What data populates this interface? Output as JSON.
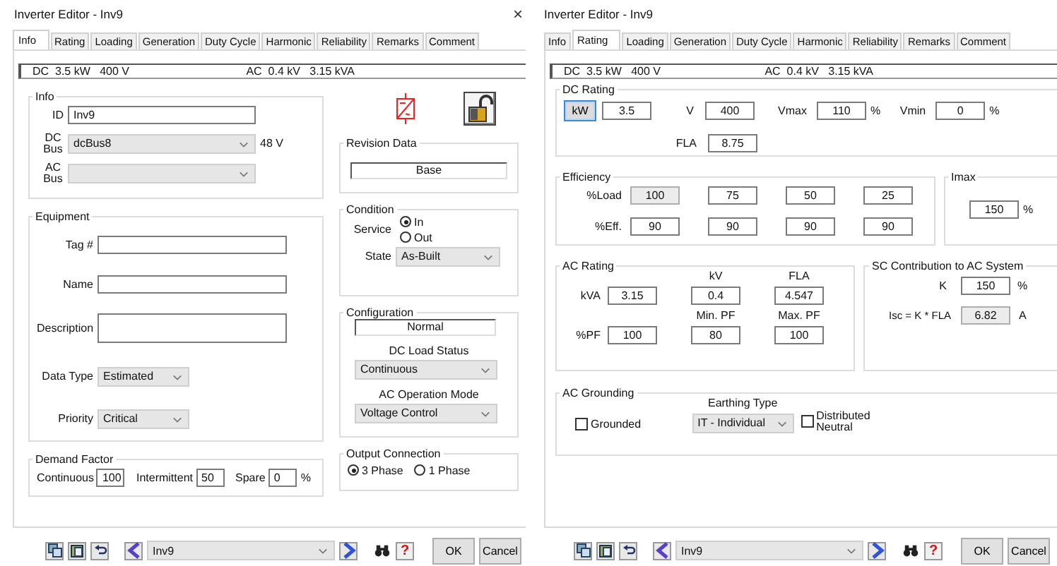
{
  "windows": [
    {
      "kind": "info",
      "title": "Inverter Editor - Inv9",
      "close": "×",
      "tabs": [
        {
          "label": "Info",
          "selected": true
        },
        {
          "label": "Rating",
          "selected": false
        },
        {
          "label": "Loading",
          "selected": false
        },
        {
          "label": "Generation",
          "selected": false
        },
        {
          "label": "Duty Cycle",
          "selected": false
        },
        {
          "label": "Harmonic",
          "selected": false
        },
        {
          "label": "Reliability",
          "selected": false
        },
        {
          "label": "Remarks",
          "selected": false
        },
        {
          "label": "Comment",
          "selected": false
        }
      ],
      "summary": {
        "dc": "DC  3.5 kW   400 V",
        "ac": "AC  0.4 kV   3.15 kVA"
      },
      "info": {
        "title": "Info",
        "id_label": "ID",
        "id_value": "Inv9",
        "dc_bus_label": "DC Bus",
        "dc_bus_value": "dcBus8",
        "dc_bus_voltage": "48 V",
        "ac_bus_label": "AC Bus"
      },
      "revision": {
        "title": "Revision Data",
        "value": "Base"
      },
      "equipment": {
        "title": "Equipment",
        "fields": [
          {
            "label": "Tag #",
            "kind": "line"
          },
          {
            "label": "Name",
            "kind": "line"
          },
          {
            "label": "Description",
            "kind": "tall"
          }
        ],
        "dropdowns": [
          {
            "label": "Data Type",
            "value": "Estimated"
          },
          {
            "label": "Priority",
            "value": "Critical"
          }
        ]
      },
      "condition": {
        "title": "Condition",
        "service_label": "Service",
        "options": [
          {
            "label": "In",
            "selected": true
          },
          {
            "label": "Out",
            "selected": false
          }
        ],
        "state_label": "State",
        "state_value": "As-Built"
      },
      "configuration": {
        "title": "Configuration",
        "value": "Normal",
        "dc_load_label": "DC Load Status",
        "dc_load_value": "Continuous",
        "ac_mode_label": "AC Operation Mode",
        "ac_mode_value": "Voltage Control"
      },
      "demand_factor": {
        "title": "Demand Factor",
        "items": [
          {
            "label": "Continuous",
            "value": "100"
          },
          {
            "label": "Intermittent",
            "value": "50"
          },
          {
            "label": "Spare",
            "value": "0",
            "unit": "%"
          }
        ]
      },
      "output_connection": {
        "title": "Output Connection",
        "options": [
          {
            "label": "3 Phase",
            "selected": true
          },
          {
            "label": "1 Phase",
            "selected": false
          }
        ]
      },
      "toolbar": {
        "item": "Inv9",
        "help": "?",
        "ok": "OK",
        "cancel": "Cancel"
      }
    },
    {
      "kind": "rating",
      "title": "Inverter Editor - Inv9",
      "tabs": [
        {
          "label": "Info",
          "selected": false
        },
        {
          "label": "Rating",
          "selected": true
        },
        {
          "label": "Loading",
          "selected": false
        },
        {
          "label": "Generation",
          "selected": false
        },
        {
          "label": "Duty Cycle",
          "selected": false
        },
        {
          "label": "Harmonic",
          "selected": false
        },
        {
          "label": "Reliability",
          "selected": false
        },
        {
          "label": "Remarks",
          "selected": false
        },
        {
          "label": "Comment",
          "selected": false
        }
      ],
      "summary": {
        "dc": "DC  3.5 kW   400 V",
        "ac": "AC  0.4 kV   3.15 kVA"
      },
      "dc_rating": {
        "title": "DC Rating",
        "unit_button": "kW",
        "power": "3.5",
        "v_label": "V",
        "v": "400",
        "vmax_label": "Vmax",
        "vmax": "110",
        "vmax_unit": "%",
        "vmin_label": "Vmin",
        "vmin": "0",
        "vmin_unit": "%",
        "fla_label": "FLA",
        "fla": "8.75"
      },
      "efficiency": {
        "title": "Efficiency",
        "rows": [
          {
            "label": "%Load",
            "cells": [
              {
                "value": "100",
                "disabled": true
              },
              {
                "value": "75",
                "disabled": false
              },
              {
                "value": "50",
                "disabled": false
              },
              {
                "value": "25",
                "disabled": false
              }
            ]
          },
          {
            "label": "%Eff.",
            "cells": [
              {
                "value": "90",
                "disabled": false
              },
              {
                "value": "90",
                "disabled": false
              },
              {
                "value": "90",
                "disabled": false
              },
              {
                "value": "90",
                "disabled": false
              }
            ]
          }
        ]
      },
      "imax": {
        "title": "Imax",
        "value": "150",
        "unit": "%"
      },
      "ac_rating": {
        "title": "AC Rating",
        "rows": [
          {
            "label": "kVA",
            "cells": [
              {
                "value": "3.15"
              },
              {
                "header": "kV",
                "value": "0.4"
              },
              {
                "header": "FLA",
                "value": "4.547"
              }
            ]
          },
          {
            "label": "%PF",
            "cells": [
              {
                "value": "100"
              },
              {
                "header": "Min. PF",
                "value": "80"
              },
              {
                "header": "Max. PF",
                "value": "100"
              }
            ]
          }
        ]
      },
      "sc_contribution": {
        "title": "SC Contribution to AC System",
        "k_label": "K",
        "k": "150",
        "k_unit": "%",
        "isc_label": "Isc = K * FLA",
        "isc": "6.82",
        "isc_unit": "A"
      },
      "ac_grounding": {
        "title": "AC Grounding",
        "grounded": {
          "label": "Grounded",
          "checked": false
        },
        "earthing_label": "Earthing Type",
        "earthing_value": "IT - Individual",
        "distributed": {
          "label": "Distributed Neutral",
          "checked": false
        }
      },
      "toolbar": {
        "item": "Inv9",
        "help": "?",
        "ok": "OK",
        "cancel": "Cancel"
      }
    }
  ]
}
